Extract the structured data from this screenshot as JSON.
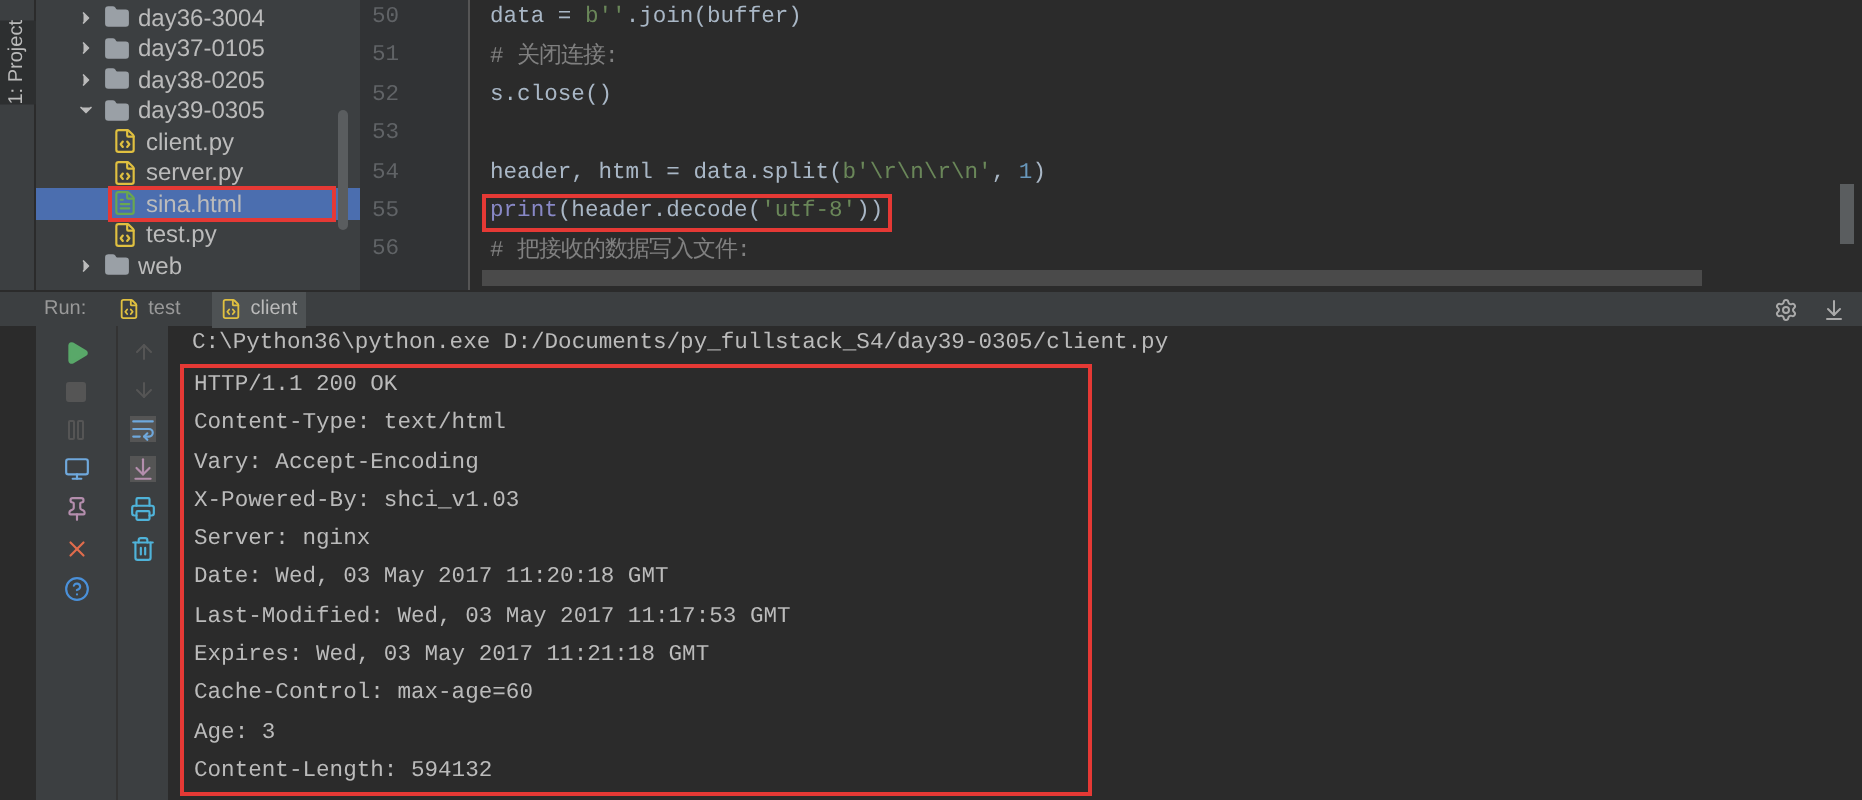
{
  "side_tab": {
    "label": "1: Project"
  },
  "project_tree": {
    "items": [
      {
        "label": "day36-3004",
        "kind": "folder",
        "expanded": false,
        "selected": false,
        "highlighted": false
      },
      {
        "label": "day37-0105",
        "kind": "folder",
        "expanded": false,
        "selected": false,
        "highlighted": false
      },
      {
        "label": "day38-0205",
        "kind": "folder",
        "expanded": false,
        "selected": false,
        "highlighted": false
      },
      {
        "label": "day39-0305",
        "kind": "folder",
        "expanded": true,
        "selected": false,
        "highlighted": false,
        "children": [
          {
            "label": "client.py",
            "kind": "python",
            "selected": false,
            "highlighted": false
          },
          {
            "label": "server.py",
            "kind": "python",
            "selected": false,
            "highlighted": false
          },
          {
            "label": "sina.html",
            "kind": "html",
            "selected": true,
            "highlighted": true
          },
          {
            "label": "test.py",
            "kind": "python",
            "selected": false,
            "highlighted": false
          }
        ]
      },
      {
        "label": "web",
        "kind": "folder",
        "expanded": false,
        "selected": false,
        "highlighted": false
      }
    ]
  },
  "editor": {
    "lines": [
      {
        "number": "50",
        "highlighted": false,
        "tokens": [
          {
            "text": "data = ",
            "kind": "plain"
          },
          {
            "text": "b''",
            "kind": "string"
          },
          {
            "text": ".join(buffer)",
            "kind": "plain"
          }
        ]
      },
      {
        "number": "51",
        "highlighted": false,
        "tokens": [
          {
            "text": "# 关闭连接:",
            "kind": "comment"
          }
        ]
      },
      {
        "number": "52",
        "highlighted": false,
        "tokens": [
          {
            "text": "s.close()",
            "kind": "plain"
          }
        ]
      },
      {
        "number": "53"
      },
      {
        "number": "54",
        "highlighted": false,
        "tokens": [
          {
            "text": "header, html = data.split(",
            "kind": "plain"
          },
          {
            "text": "b'\\r\\n\\r\\n'",
            "kind": "string"
          },
          {
            "text": ", ",
            "kind": "plain"
          },
          {
            "text": "1",
            "kind": "number"
          },
          {
            "text": ")",
            "kind": "plain"
          }
        ]
      },
      {
        "number": "55",
        "highlighted": true,
        "tokens": [
          {
            "text": "print",
            "kind": "builtin"
          },
          {
            "text": "(header.decode(",
            "kind": "plain"
          },
          {
            "text": "'utf-8'",
            "kind": "string"
          },
          {
            "text": "))",
            "kind": "plain"
          }
        ]
      },
      {
        "number": "56",
        "highlighted": false,
        "tokens": [
          {
            "text": "# 把接收的数据写入文件:",
            "kind": "comment"
          }
        ]
      }
    ]
  },
  "run_bar": {
    "label": "Run:",
    "tabs": [
      {
        "label": "test",
        "selected": false
      },
      {
        "label": "client",
        "selected": true
      }
    ]
  },
  "console": {
    "command": "C:\\Python36\\python.exe D:/Documents/py_fullstack_S4/day39-0305/client.py",
    "output_highlighted": true,
    "output": [
      "HTTP/1.1 200 OK",
      "Content-Type: text/html",
      "Vary: Accept-Encoding",
      "X-Powered-By: shci_v1.03",
      "Server: nginx",
      "Date: Wed, 03 May 2017 11:20:18 GMT",
      "Last-Modified: Wed, 03 May 2017 11:17:53 GMT",
      "Expires: Wed, 03 May 2017 11:21:18 GMT",
      "Cache-Control: max-age=60",
      "Age: 3",
      "Content-Length: 594132"
    ]
  }
}
